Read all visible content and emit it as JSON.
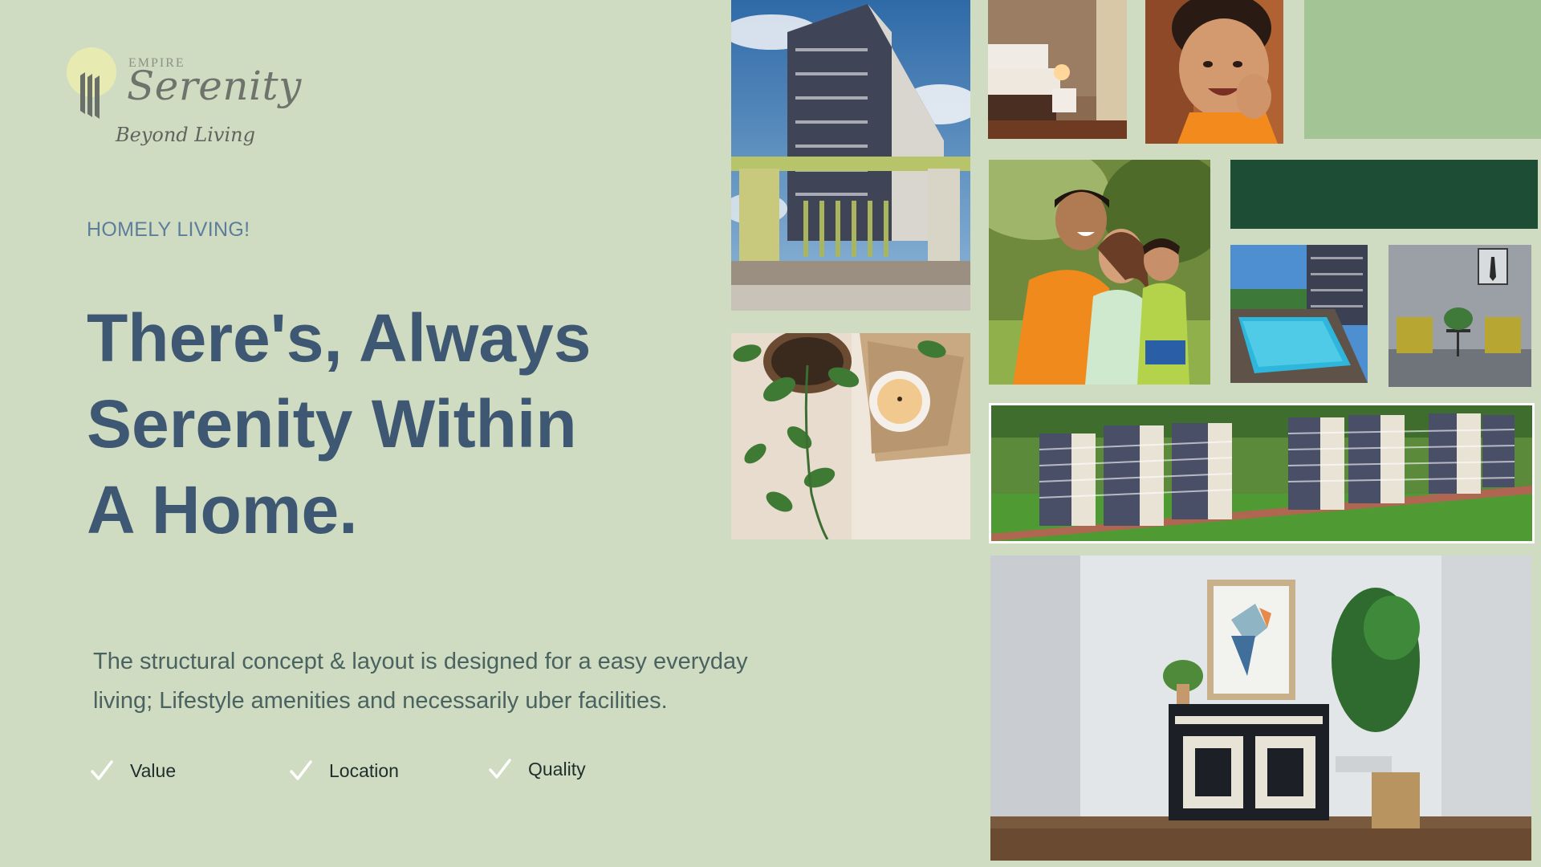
{
  "logo": {
    "brand": "EMPIRE",
    "name": "Serenity",
    "tagline": "Beyond Living"
  },
  "hero": {
    "eyebrow": "HOMELY LIVING!",
    "headline": [
      "There's, Always",
      "Serenity Within",
      "A Home."
    ],
    "description": "The structural concept & layout is designed for a easy everyday living; Lifestyle amenities and necessarily uber facilities."
  },
  "features": [
    {
      "label": "Value",
      "icon": "checkmark-icon"
    },
    {
      "label": "Location",
      "icon": "checkmark-icon"
    },
    {
      "label": "Quality",
      "icon": "checkmark-icon"
    }
  ],
  "photos": [
    {
      "name": "building-exterior-photo"
    },
    {
      "name": "bedroom-photo"
    },
    {
      "name": "smiling-child-photo"
    },
    {
      "name": "light-green-block"
    },
    {
      "name": "family-portrait-photo"
    },
    {
      "name": "dark-green-block"
    },
    {
      "name": "swimming-pool-photo"
    },
    {
      "name": "lounge-chairs-photo"
    },
    {
      "name": "plant-candle-photo"
    },
    {
      "name": "apartment-complex-aerial-photo"
    },
    {
      "name": "interior-hallway-photo"
    }
  ],
  "colors": {
    "background": "#cfdcc2",
    "headline": "#3e5772",
    "eyebrow": "#5d7d9a",
    "body_text": "#4a6260",
    "light_green_block": "#a3c596",
    "dark_green_block": "#1e4d36"
  }
}
